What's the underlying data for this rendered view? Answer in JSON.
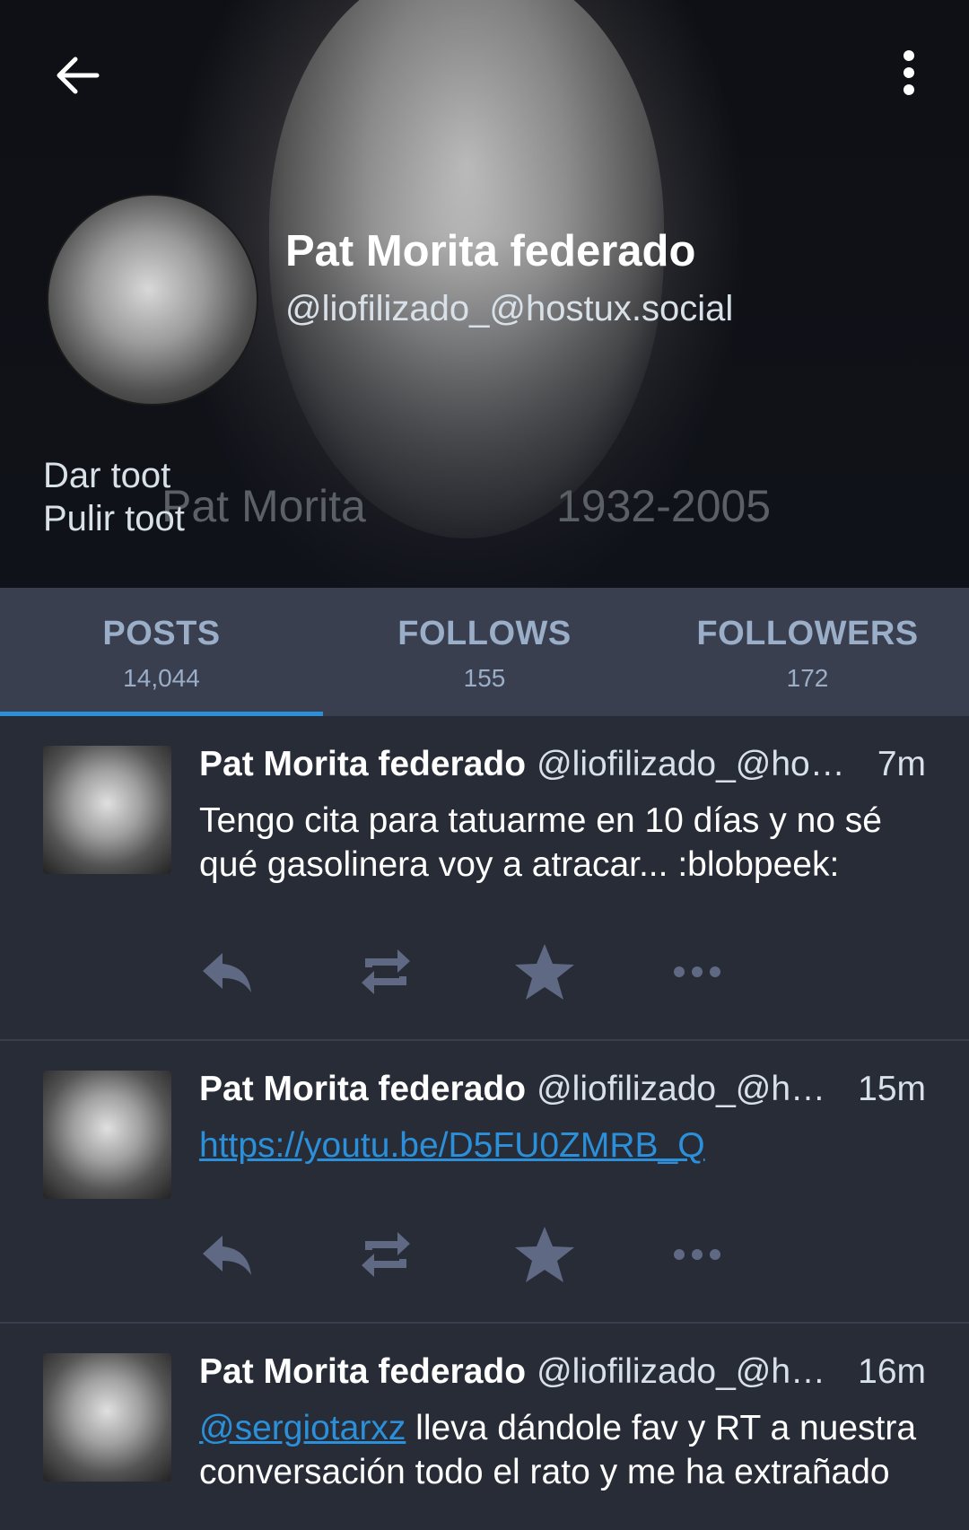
{
  "header": {
    "banner_caption_name": "Pat Morita",
    "banner_caption_years": "1932-2005",
    "display_name": "Pat Morita federado",
    "account": "@liofilizado_@hostux.social",
    "note_lines": [
      "Dar toot",
      "Pulir toot"
    ]
  },
  "tabs": [
    {
      "label": "POSTS",
      "count": "14,044",
      "active": true
    },
    {
      "label": "FOLLOWS",
      "count": "155",
      "active": false
    },
    {
      "label": "FOLLOWERS",
      "count": "172",
      "active": false
    }
  ],
  "statuses": [
    {
      "name": "Pat Morita federado",
      "acct": "@liofilizado_@ho…",
      "time": "7m",
      "content": "Tengo cita para tatuarme en 10 días y no sé qué gasolinera voy a atracar... :blobpeek:"
    },
    {
      "name": "Pat Morita federado",
      "acct": "@liofilizado_@h…",
      "time": "15m",
      "link": "https://youtu.be/D5FU0ZMRB_Q"
    },
    {
      "name": "Pat Morita federado",
      "acct": "@liofilizado_@h…",
      "time": "16m",
      "mention": "@sergiotarxz",
      "content_after_mention": " lleva dándole fav y RT a nuestra conversación todo el rato y me ha extrañado"
    }
  ],
  "icons": {
    "back": "arrow-left-icon",
    "menu": "more-vertical-icon",
    "reply": "reply-icon",
    "boost": "retweet-icon",
    "favourite": "star-icon",
    "more": "more-horizontal-icon"
  },
  "colors": {
    "background": "#282c37",
    "tab_bar": "#393f4f",
    "accent": "#2b90d9",
    "muted": "#9baec8",
    "action_icon": "#606984"
  }
}
